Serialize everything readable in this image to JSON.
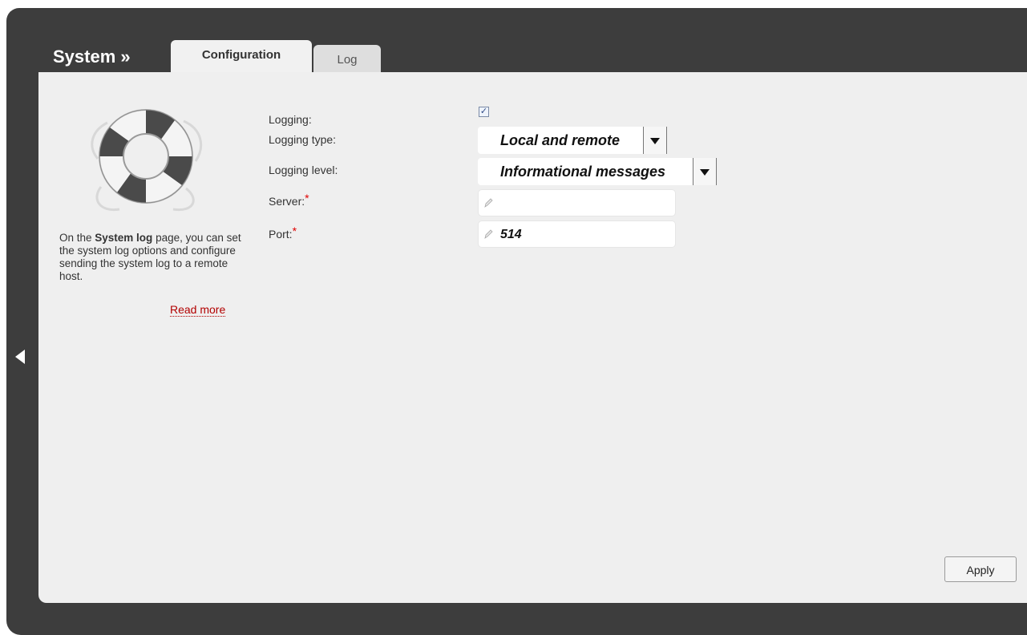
{
  "header": {
    "title": "System »",
    "tabs": [
      {
        "label": "Configuration",
        "active": true
      },
      {
        "label": "Log",
        "active": false
      }
    ]
  },
  "help": {
    "text_prefix": "On the ",
    "text_bold": "System log",
    "text_suffix": " page, you can set the system log options and configure sending the system log to a remote host.",
    "read_more": "Read more",
    "icon": "lifebuoy-icon"
  },
  "form": {
    "logging": {
      "label": "Logging:",
      "checked": true,
      "check_glyph": "✓"
    },
    "logging_type": {
      "label": "Logging type:",
      "value": "Local and remote"
    },
    "logging_level": {
      "label": "Logging level:",
      "value": "Informational messages"
    },
    "server": {
      "label": "Server:",
      "required_mark": "*",
      "value": ""
    },
    "port": {
      "label": "Port:",
      "required_mark": "*",
      "value": "514"
    }
  },
  "actions": {
    "apply_label": "Apply"
  },
  "colors": {
    "frame": "#3d3d3d",
    "panel": "#efefef",
    "link": "#b20000",
    "required": "#e00000"
  }
}
